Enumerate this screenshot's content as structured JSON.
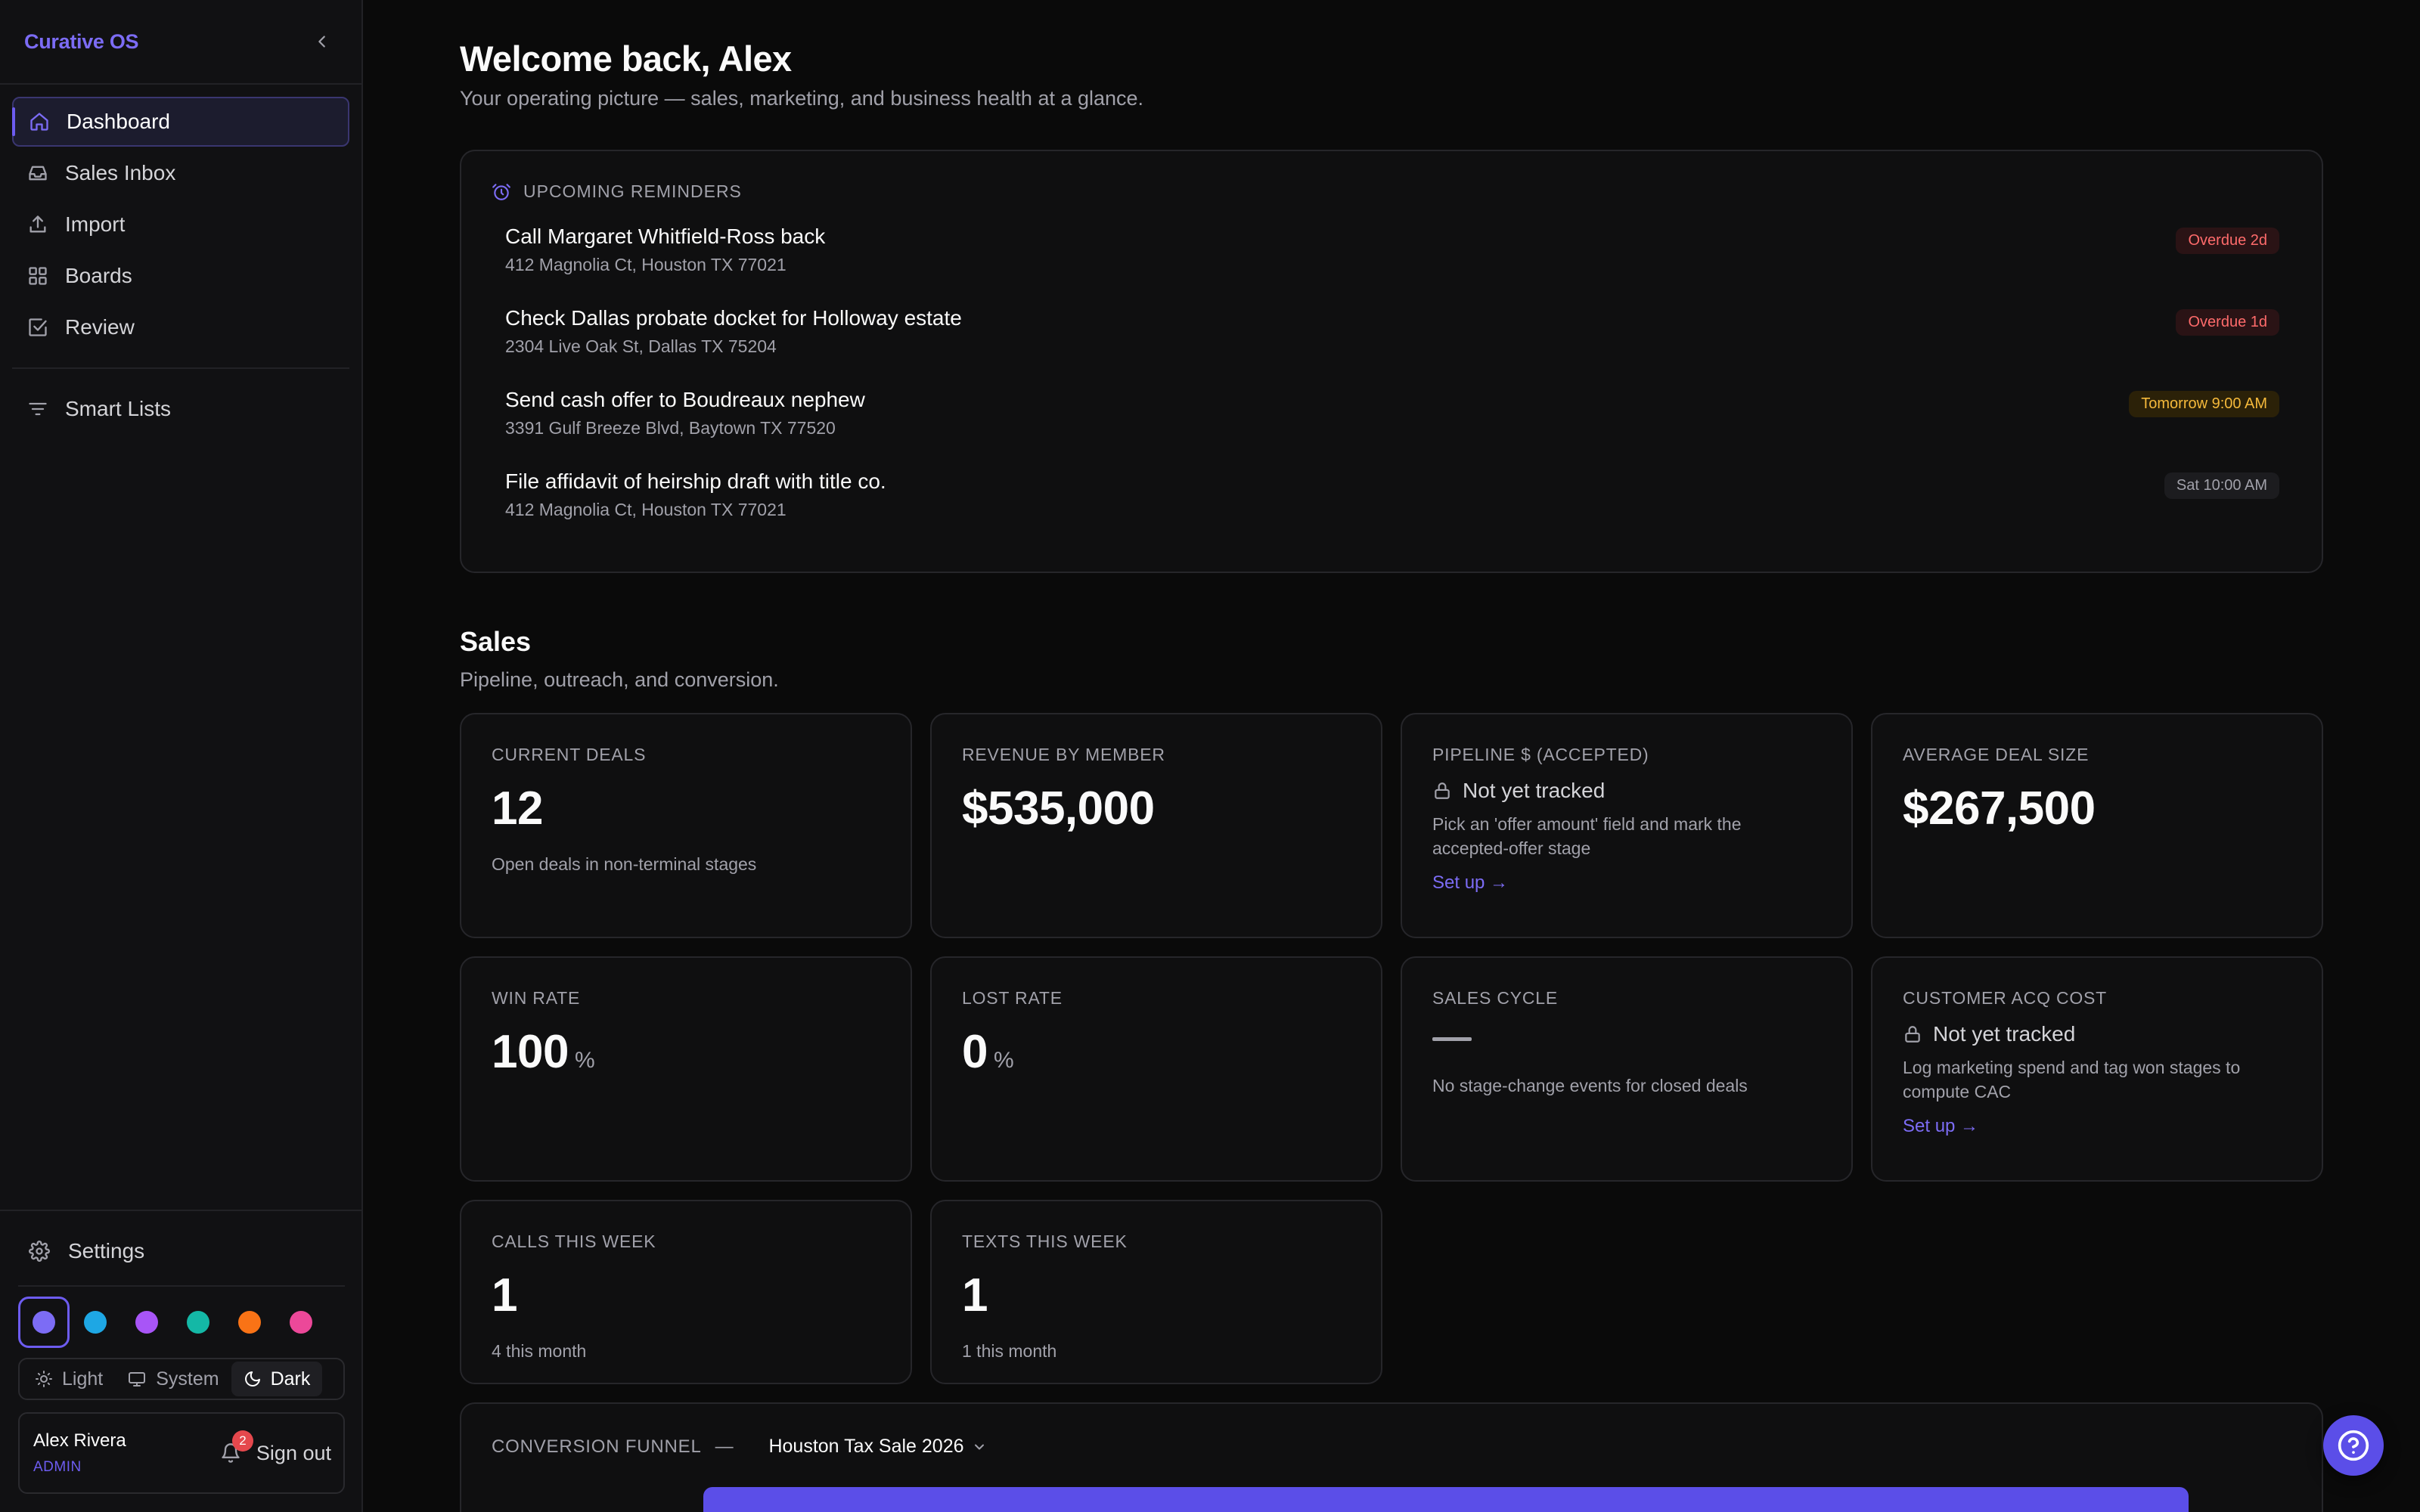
{
  "app": {
    "brand": "Curative OS"
  },
  "sidebar": {
    "items": [
      {
        "label": "Dashboard",
        "icon": "home-icon",
        "active": true
      },
      {
        "label": "Sales Inbox",
        "icon": "inbox-icon"
      },
      {
        "label": "Import",
        "icon": "upload-icon"
      },
      {
        "label": "Boards",
        "icon": "grid-icon"
      },
      {
        "label": "Review",
        "icon": "checkbox-icon"
      }
    ],
    "secondary": [
      {
        "label": "Smart Lists",
        "icon": "filter-icon"
      }
    ],
    "settings_label": "Settings",
    "swatches": [
      "#7c6cf5",
      "#1ea7e4",
      "#a855f7",
      "#14b8a6",
      "#f97316",
      "#ec4899"
    ],
    "theme": {
      "light": "Light",
      "system": "System",
      "dark": "Dark",
      "selected": "Dark"
    },
    "user": {
      "name": "Alex Rivera",
      "role": "ADMIN",
      "notifications": "2",
      "signout": "Sign out"
    }
  },
  "header": {
    "title": "Welcome back, Alex",
    "subtitle": "Your operating picture — sales, marketing, and business health at a glance."
  },
  "reminders": {
    "heading": "UPCOMING REMINDERS",
    "items": [
      {
        "title": "Call Margaret Whitfield-Ross back",
        "address": "412 Magnolia Ct, Houston TX 77021",
        "badge": "Overdue 2d",
        "status": "overdue"
      },
      {
        "title": "Check Dallas probate docket for Holloway estate",
        "address": "2304 Live Oak St, Dallas TX 75204",
        "badge": "Overdue 1d",
        "status": "overdue"
      },
      {
        "title": "Send cash offer to Boudreaux nephew",
        "address": "3391 Gulf Breeze Blvd, Baytown TX 77520",
        "badge": "Tomorrow 9:00 AM",
        "status": "upcoming"
      },
      {
        "title": "File affidavit of heirship draft with title co.",
        "address": "412 Magnolia Ct, Houston TX 77021",
        "badge": "Sat 10:00 AM",
        "status": "scheduled"
      }
    ]
  },
  "sales": {
    "title": "Sales",
    "subtitle": "Pipeline, outreach, and conversion.",
    "cards": {
      "current_deals": {
        "label": "CURRENT DEALS",
        "value": "12",
        "note": "Open deals in non-terminal stages"
      },
      "revenue_by_member": {
        "label": "REVENUE BY MEMBER",
        "value": "$535,000"
      },
      "pipeline": {
        "label": "PIPELINE $ (ACCEPTED)",
        "status": "Not yet tracked",
        "desc": "Pick an 'offer amount' field and mark the accepted-offer stage",
        "link": "Set up →"
      },
      "avg_deal": {
        "label": "AVERAGE DEAL SIZE",
        "value": "$267,500"
      },
      "win_rate": {
        "label": "WIN RATE",
        "value": "100",
        "unit": "%"
      },
      "lost_rate": {
        "label": "LOST RATE",
        "value": "0",
        "unit": "%"
      },
      "sales_cycle": {
        "label": "SALES CYCLE",
        "note": "No stage-change events for closed deals"
      },
      "cac": {
        "label": "CUSTOMER ACQ COST",
        "status": "Not yet tracked",
        "desc": "Log marketing spend and tag won stages to compute CAC",
        "link": "Set up →"
      },
      "calls": {
        "label": "CALLS THIS WEEK",
        "value": "1",
        "note": "4 this month"
      },
      "texts": {
        "label": "TEXTS THIS WEEK",
        "value": "1",
        "note": "1 this month"
      }
    }
  },
  "funnel": {
    "label": "CONVERSION FUNNEL",
    "separator": "—",
    "selected_board": "Houston Tax Sale 2026"
  }
}
